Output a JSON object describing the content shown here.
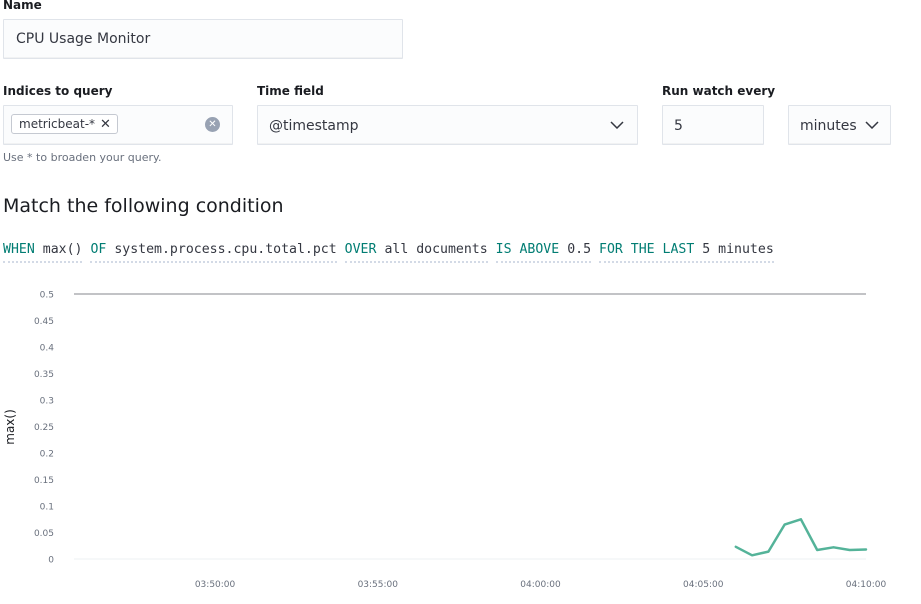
{
  "form": {
    "name": {
      "label": "Name",
      "value": "CPU Usage Monitor"
    },
    "indices": {
      "label": "Indices to query",
      "pill": "metricbeat-*",
      "remove_icon": "close-icon",
      "clear_icon": "clear-circle-icon",
      "help": "Use * to broaden your query."
    },
    "time_field": {
      "label": "Time field",
      "value": "@timestamp",
      "icon": "chevron-down-icon"
    },
    "run_every": {
      "label": "Run watch every",
      "value": "5",
      "unit": "minutes",
      "icon": "chevron-down-icon"
    }
  },
  "condition": {
    "title": "Match the following condition",
    "when_kw": "WHEN",
    "when_val": "max()",
    "of_kw": "OF",
    "of_val": "system.process.cpu.total.pct",
    "over_kw": "OVER",
    "over_val": "all documents",
    "is_kw": "IS ABOVE",
    "is_val": "0.5",
    "for_kw": "FOR THE LAST",
    "for_val": "5 minutes"
  },
  "colors": {
    "keyword": "#017d73",
    "series": "#54b399",
    "threshold": "#c2c3c6",
    "axis_text": "#69707d"
  },
  "chart_data": {
    "type": "line",
    "ylabel": "max()",
    "xlabel": "",
    "ylim": [
      0,
      0.5
    ],
    "yticks": [
      "0",
      "0.05",
      "0.1",
      "0.15",
      "0.2",
      "0.25",
      "0.3",
      "0.35",
      "0.4",
      "0.45",
      "0.5"
    ],
    "xlim": [
      "03:45:40",
      "04:10:00"
    ],
    "xticks": [
      "03:50:00",
      "03:55:00",
      "04:00:00",
      "04:05:00",
      "04:10:00"
    ],
    "threshold": 0.5,
    "series": [
      {
        "x": [
          "04:06:00",
          "04:06:30",
          "04:07:00",
          "04:07:30",
          "04:08:00",
          "04:08:30",
          "04:09:00",
          "04:09:30",
          "04:10:00"
        ],
        "y": [
          0.023,
          0.007,
          0.014,
          0.065,
          0.075,
          0.017,
          0.022,
          0.017,
          0.018
        ]
      }
    ]
  }
}
